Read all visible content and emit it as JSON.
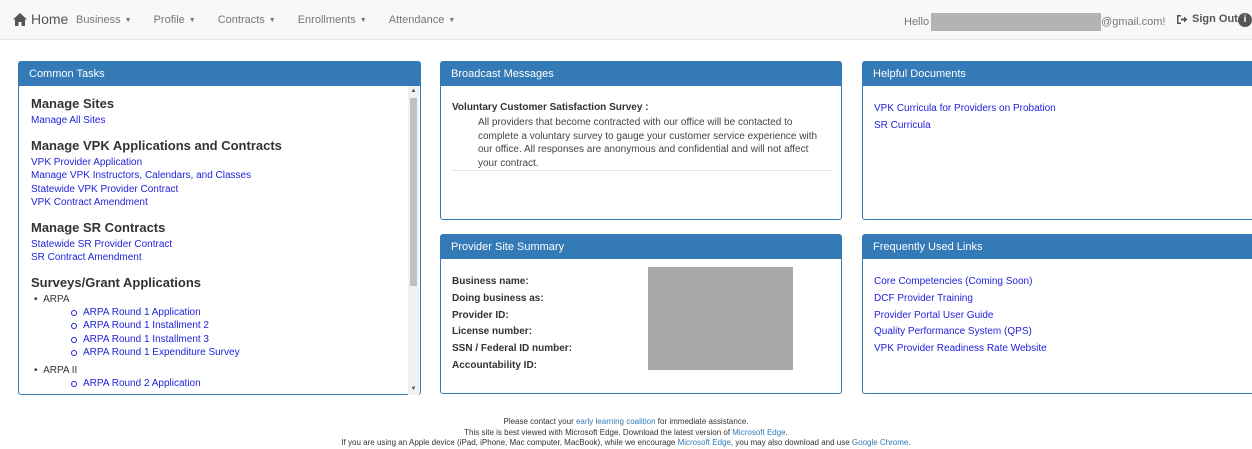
{
  "nav": {
    "home": "Home",
    "menus": [
      "Business",
      "Profile",
      "Contracts",
      "Enrollments",
      "Attendance"
    ],
    "hello": "Hello",
    "email_suffix": "@gmail.com!",
    "sign_out": "Sign Out"
  },
  "common_tasks": {
    "title": "Common Tasks",
    "sections": [
      {
        "heading": "Manage Sites",
        "links": [
          "Manage All Sites"
        ]
      },
      {
        "heading": "Manage VPK Applications and Contracts",
        "links": [
          "VPK Provider Application",
          "Manage VPK Instructors, Calendars, and Classes",
          "Statewide VPK Provider Contract",
          "VPK Contract Amendment"
        ]
      },
      {
        "heading": "Manage SR Contracts",
        "links": [
          "Statewide SR Provider Contract",
          "SR Contract Amendment"
        ]
      },
      {
        "heading": "Surveys/Grant Applications"
      }
    ],
    "surveys": [
      {
        "label": "ARPA",
        "items": [
          "ARPA Round 1 Application",
          "ARPA Round 1 Installment 2",
          "ARPA Round 1 Installment 3",
          "ARPA Round 1 Expenditure Survey"
        ]
      },
      {
        "label": "ARPA II",
        "items": [
          "ARPA Round 2 Application"
        ]
      }
    ]
  },
  "broadcast": {
    "title": "Broadcast Messages",
    "message_title": "Voluntary Customer Satisfaction Survey :",
    "message_body": "All providers that become contracted with our office will be contacted to complete a voluntary survey to gauge your customer service experience with our office. All responses are anonymous and confidential and will not affect your contract."
  },
  "helpful": {
    "title": "Helpful Documents",
    "links": [
      "VPK Curricula for Providers on Probation",
      "SR Curricula"
    ]
  },
  "summary": {
    "title": "Provider Site Summary",
    "labels": [
      "Business name:",
      "Doing business as:",
      "Provider ID:",
      "License number:",
      "SSN / Federal ID number:",
      "Accountability ID:"
    ]
  },
  "frequent": {
    "title": "Frequently Used Links",
    "links": [
      "Core Competencies (Coming Soon)",
      "DCF Provider Training",
      "Provider Portal User Guide",
      "Quality Performance System (QPS)",
      "VPK Provider Readiness Rate Website"
    ]
  },
  "footer": {
    "line1_pre": "Please contact your ",
    "line1_link": "early learning coalition",
    "line1_post": " for immediate assistance.",
    "line2_pre": "This site is best viewed with Microsoft Edge. Download the latest version of ",
    "line2_link": "Microsoft Edge",
    "line2_post": ".",
    "line3_pre": "If you are using an Apple device (iPad, iPhone, Mac computer, MacBook), while we encourage ",
    "line3_link1": "Microsoft Edge",
    "line3_mid": ", you may also download and use ",
    "line3_link2": "Google Chrome",
    "line3_post": "."
  },
  "colors": {
    "primary": "#337ab7",
    "link": "#2222dd",
    "navbar": "#f8f8f8"
  },
  "icons": [
    "home-icon",
    "caret-down-icon",
    "sign-out-icon",
    "info-icon",
    "scroll-up-icon",
    "scroll-down-icon"
  ]
}
